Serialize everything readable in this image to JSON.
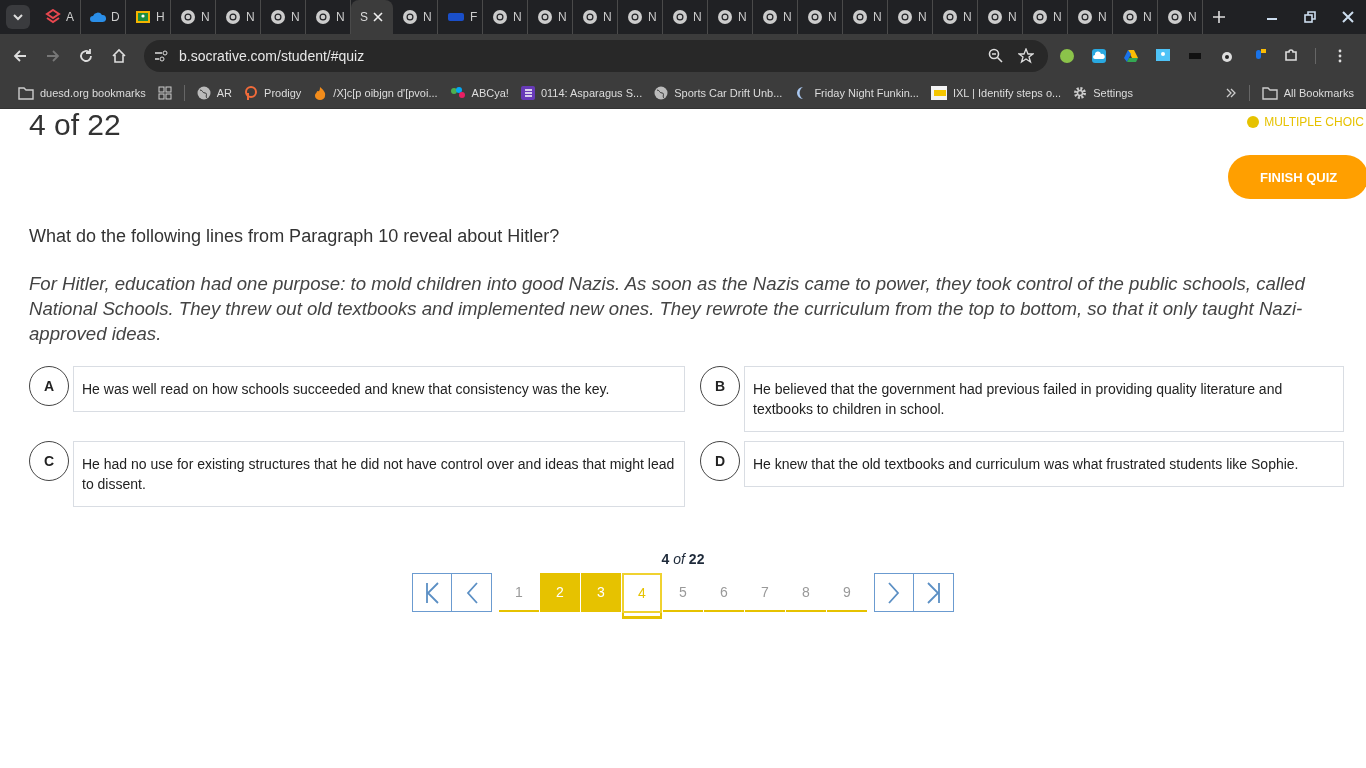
{
  "tabs": [
    {
      "label": "A",
      "kind": "socrative",
      "selected": false
    },
    {
      "label": "D",
      "kind": "cloud",
      "selected": false
    },
    {
      "label": "H",
      "kind": "classroom",
      "selected": false
    },
    {
      "label": "N",
      "kind": "chrome",
      "selected": false
    },
    {
      "label": "N",
      "kind": "chrome",
      "selected": false
    },
    {
      "label": "N",
      "kind": "chrome",
      "selected": false
    },
    {
      "label": "N",
      "kind": "chrome",
      "selected": false
    },
    {
      "label": "S",
      "kind": "plain",
      "selected": true
    },
    {
      "label": "N",
      "kind": "chrome",
      "selected": false
    },
    {
      "label": "F",
      "kind": "filo",
      "selected": false
    },
    {
      "label": "N",
      "kind": "chrome",
      "selected": false
    },
    {
      "label": "N",
      "kind": "chrome",
      "selected": false
    },
    {
      "label": "N",
      "kind": "chrome",
      "selected": false
    },
    {
      "label": "N",
      "kind": "chrome",
      "selected": false
    },
    {
      "label": "N",
      "kind": "chrome",
      "selected": false
    },
    {
      "label": "N",
      "kind": "chrome",
      "selected": false
    },
    {
      "label": "N",
      "kind": "chrome",
      "selected": false
    },
    {
      "label": "N",
      "kind": "chrome",
      "selected": false
    },
    {
      "label": "N",
      "kind": "chrome",
      "selected": false
    },
    {
      "label": "N",
      "kind": "chrome",
      "selected": false
    },
    {
      "label": "N",
      "kind": "chrome",
      "selected": false
    },
    {
      "label": "N",
      "kind": "chrome",
      "selected": false
    },
    {
      "label": "N",
      "kind": "chrome",
      "selected": false
    },
    {
      "label": "N",
      "kind": "chrome",
      "selected": false
    },
    {
      "label": "N",
      "kind": "chrome",
      "selected": false
    },
    {
      "label": "N",
      "kind": "chrome",
      "selected": false
    }
  ],
  "address_bar": {
    "url": "b.socrative.com/student/#quiz"
  },
  "bookmarks": [
    {
      "label": "duesd.org bookmarks",
      "kind": "folder"
    },
    {
      "kind": "grid"
    },
    {
      "label": "AR",
      "kind": "globe"
    },
    {
      "label": "Prodigy",
      "kind": "prodigy"
    },
    {
      "label": "/X]c[p oibjgn d'[pvoi...",
      "kind": "fire"
    },
    {
      "label": "ABCya!",
      "kind": "abcya"
    },
    {
      "label": "0114: Asparagus S...",
      "kind": "list"
    },
    {
      "label": "Sports Car Drift Unb...",
      "kind": "globe"
    },
    {
      "label": "Friday Night Funkin...",
      "kind": "moon"
    },
    {
      "label": "IXL | Identify steps o...",
      "kind": "ixl"
    },
    {
      "label": "Settings",
      "kind": "gear"
    }
  ],
  "all_bookmarks": "All Bookmarks",
  "quiz": {
    "progress": "4 of 22",
    "question_type": "MULTIPLE CHOIC",
    "finish_button": "FINISH QUIZ",
    "question": "What do the following lines from Paragraph 10 reveal about Hitler?",
    "passage": "For Hitler, education had one purpose: to mold children into good Nazis. As soon as the Nazis came to power, they took control of the public schools, called National Schools. They threw out old textbooks and implemented new ones. They rewrote the curriculum from the top to bottom, so that it only taught Nazi-approved ideas.",
    "answers": [
      {
        "letter": "A",
        "text": "He was well read on how schools succeeded and knew that consistency was the key.",
        "selected": false
      },
      {
        "letter": "B",
        "text": "He believed that the government had previous failed in providing quality literature and textbooks to children in school.",
        "selected": false
      },
      {
        "letter": "C",
        "text": "He had no use for existing structures that he did not have control over and ideas that might lead to dissent.",
        "selected": false
      },
      {
        "letter": "D",
        "text": "He knew that the old textbooks and curriculum was what frustrated students like Sophie.",
        "selected": false
      }
    ]
  },
  "pagination": {
    "counter": "**4** *of* **22**",
    "pages": [
      {
        "label": "1",
        "answered": false,
        "selected": false
      },
      {
        "label": "2",
        "answered": true,
        "selected": false
      },
      {
        "label": "3",
        "answered": true,
        "selected": false
      },
      {
        "label": "4",
        "answered": false,
        "selected": true
      },
      {
        "label": "5",
        "answered": false,
        "selected": false
      },
      {
        "label": "6",
        "answered": false,
        "selected": false
      },
      {
        "label": "7",
        "answered": false,
        "selected": false
      },
      {
        "label": "8",
        "answered": false,
        "selected": false
      },
      {
        "label": "9",
        "answered": false,
        "selected": false
      }
    ]
  }
}
